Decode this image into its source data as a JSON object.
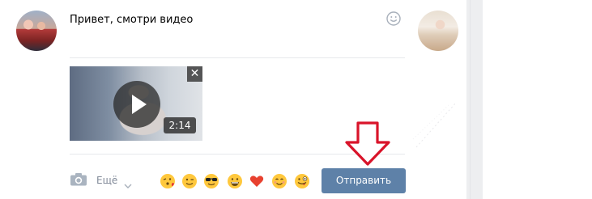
{
  "message": {
    "text": "Привет, смотри видео"
  },
  "attachment": {
    "duration": "2:14",
    "close_label": "✕"
  },
  "composer": {
    "more_label": "Ещё",
    "send_label": "Отправить",
    "emoji_quick": [
      "kissing-wink",
      "winking-face",
      "sunglasses-face",
      "grinning-face",
      "red-heart",
      "smiling-face",
      "crazy-face"
    ]
  },
  "colors": {
    "send_button": "#5e81a8",
    "muted_text": "#828a99",
    "arrow": "#d9142a"
  }
}
